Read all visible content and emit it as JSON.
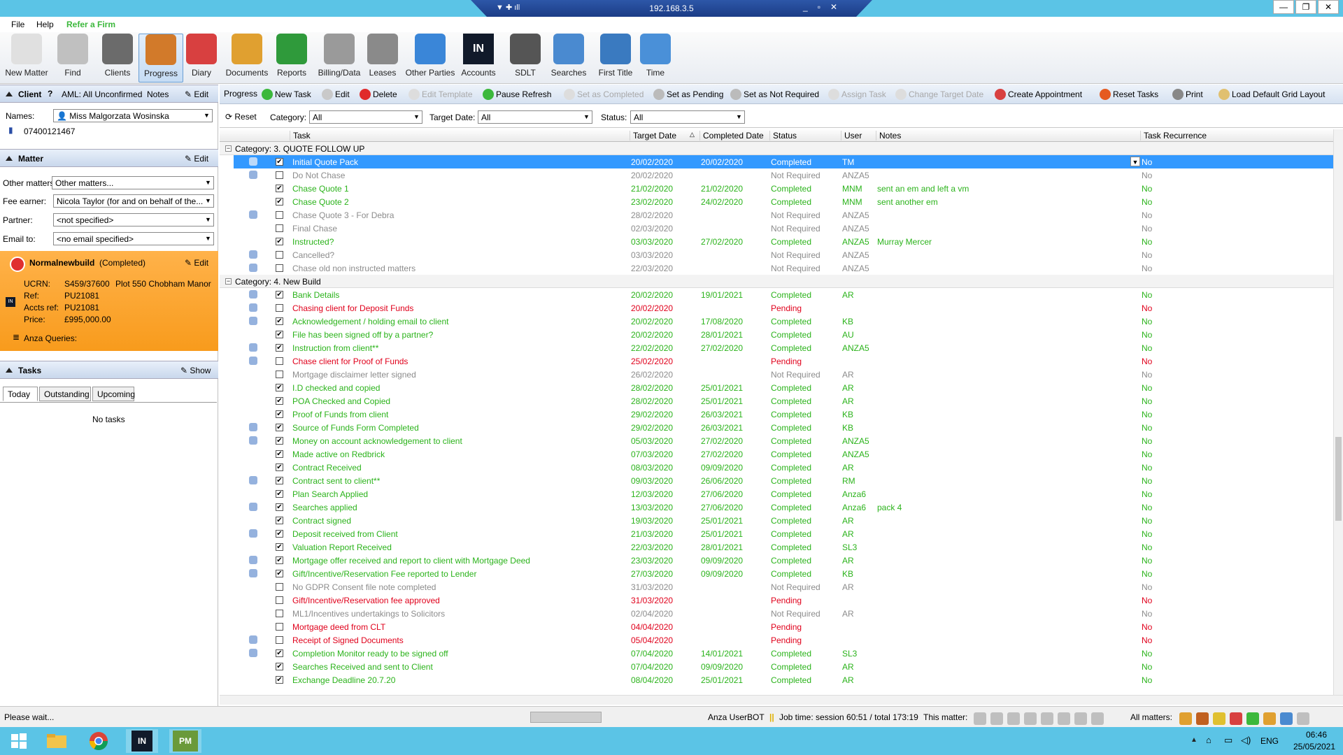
{
  "rdp": {
    "ip": "192.168.3.5"
  },
  "menu": {
    "file": "File",
    "help": "Help",
    "refer": "Refer a Firm"
  },
  "ribbon": [
    {
      "label": "New Matter",
      "icon": "document-icon",
      "color": "#e0e0e0"
    },
    {
      "label": "Find",
      "icon": "magnifier-icon",
      "color": "#c0c0c0"
    },
    {
      "label": "Clients",
      "icon": "people-icon",
      "color": "#6b6b6b"
    },
    {
      "label": "Progress",
      "icon": "progress-tag-icon",
      "color": "#d27a2a"
    },
    {
      "label": "Diary",
      "icon": "calendar-icon",
      "color": "#d84040"
    },
    {
      "label": "Documents",
      "icon": "documents-icon",
      "color": "#e0a030"
    },
    {
      "label": "Reports",
      "icon": "excel-icon",
      "color": "#2f9a3b"
    },
    {
      "label": "Billing/Data",
      "icon": "printer-icon",
      "color": "#9a9a9a"
    },
    {
      "label": "Leases",
      "icon": "calculator-icon",
      "color": "#8a8a8a"
    },
    {
      "label": "Other Parties",
      "icon": "person-icon",
      "color": "#3a86d8"
    },
    {
      "label": "Accounts",
      "icon": "in-logo-icon",
      "color": "#111a2a"
    },
    {
      "label": "SDLT",
      "icon": "house-icon",
      "color": "#555555"
    },
    {
      "label": "Searches",
      "icon": "globe-icon",
      "color": "#4a8ad0"
    },
    {
      "label": "First Title",
      "icon": "globe-pen-icon",
      "color": "#3a7ac0"
    },
    {
      "label": "Time",
      "icon": "stopwatch-icon",
      "color": "#4a90d8"
    }
  ],
  "client": {
    "title": "Client",
    "aml": "AML: All Unconfirmed",
    "notes": "Notes",
    "edit": "Edit",
    "names_label": "Names:",
    "name": "Miss Malgorzata Wosinska",
    "phone": "07400121467"
  },
  "matter": {
    "title": "Matter",
    "edit": "Edit",
    "other_label": "Other matters:",
    "other_value": "Other matters...",
    "fee_label": "Fee earner:",
    "fee_value": "Nicola Taylor (for and on behalf of the...",
    "partner_label": "Partner:",
    "partner_value": "<not specified>",
    "email_label": "Email to:",
    "email_value": "<no email specified>"
  },
  "matterbox": {
    "name": "Normalnewbuild",
    "state": "(Completed)",
    "edit": "Edit",
    "ucrn_k": "UCRN:",
    "ucrn_v": "S459/37600",
    "plot": "Plot 550 Chobham Manor",
    "ref_k": "Ref:",
    "ref_v": "PU21081",
    "accts_k": "Accts ref:",
    "accts_v": "PU21081",
    "price_k": "Price:",
    "price_v": "£995,000.00",
    "queries": "Anza Queries:"
  },
  "tasks": {
    "title": "Tasks",
    "show": "Show",
    "tabs": [
      "Today",
      "Outstanding",
      "Upcoming"
    ],
    "empty": "No tasks"
  },
  "toolbar": {
    "progress": "Progress",
    "new_task": "New Task",
    "edit": "Edit",
    "delete": "Delete",
    "edit_template": "Edit Template",
    "pause": "Pause Refresh",
    "set_completed": "Set as Completed",
    "set_pending": "Set as Pending",
    "set_not_required": "Set as Not Required",
    "assign": "Assign Task",
    "change_target": "Change Target Date",
    "create_appt": "Create Appointment",
    "reset_tasks": "Reset Tasks",
    "print": "Print",
    "load_grid": "Load Default Grid Layout"
  },
  "filter": {
    "reset": "Reset",
    "category_label": "Category:",
    "category": "All",
    "target_label": "Target Date:",
    "target": "All",
    "status_label": "Status:",
    "status": "All"
  },
  "columns": {
    "task": "Task",
    "target": "Target Date",
    "completed": "Completed Date",
    "status": "Status",
    "user": "User",
    "notes": "Notes",
    "recurrence": "Task Recurrence"
  },
  "categories": [
    "Category: 3. QUOTE FOLLOW UP",
    "Category: 4. New Build"
  ],
  "rows": [
    {
      "cat": 0,
      "icon": true,
      "checked": true,
      "task": "Initial Quote Pack",
      "target": "20/02/2020",
      "completed": "20/02/2020",
      "status": "Completed",
      "user": "TM",
      "notes": "",
      "rec": "No",
      "st": "sel"
    },
    {
      "cat": 0,
      "icon": true,
      "checked": false,
      "task": "Do Not Chase",
      "target": "20/02/2020",
      "completed": "",
      "status": "Not Required",
      "user": "ANZA5",
      "notes": "",
      "rec": "No",
      "st": "n"
    },
    {
      "cat": 0,
      "icon": false,
      "checked": true,
      "task": "Chase Quote 1",
      "target": "21/02/2020",
      "completed": "21/02/2020",
      "status": "Completed",
      "user": "MNM",
      "notes": "sent an em and left a vm",
      "rec": "No",
      "st": "g"
    },
    {
      "cat": 0,
      "icon": false,
      "checked": true,
      "task": "Chase Quote 2",
      "target": "23/02/2020",
      "completed": "24/02/2020",
      "status": "Completed",
      "user": "MNM",
      "notes": "sent another em",
      "rec": "No",
      "st": "g"
    },
    {
      "cat": 0,
      "icon": true,
      "checked": false,
      "task": "Chase Quote 3 - For Debra",
      "target": "28/02/2020",
      "completed": "",
      "status": "Not Required",
      "user": "ANZA5",
      "notes": "",
      "rec": "No",
      "st": "n"
    },
    {
      "cat": 0,
      "icon": false,
      "checked": false,
      "task": "Final Chase",
      "target": "02/03/2020",
      "completed": "",
      "status": "Not Required",
      "user": "ANZA5",
      "notes": "",
      "rec": "No",
      "st": "n"
    },
    {
      "cat": 0,
      "icon": false,
      "checked": true,
      "task": "Instructed?",
      "target": "03/03/2020",
      "completed": "27/02/2020",
      "status": "Completed",
      "user": "ANZA5",
      "notes": "Murray Mercer",
      "rec": "No",
      "st": "g"
    },
    {
      "cat": 0,
      "icon": true,
      "checked": false,
      "task": "Cancelled?",
      "target": "03/03/2020",
      "completed": "",
      "status": "Not Required",
      "user": "ANZA5",
      "notes": "",
      "rec": "No",
      "st": "n"
    },
    {
      "cat": 0,
      "icon": true,
      "checked": false,
      "task": "Chase old non instructed matters",
      "target": "22/03/2020",
      "completed": "",
      "status": "Not Required",
      "user": "ANZA5",
      "notes": "",
      "rec": "No",
      "st": "n"
    },
    {
      "cat": 1,
      "icon": true,
      "checked": true,
      "task": "Bank Details",
      "target": "20/02/2020",
      "completed": "19/01/2021",
      "status": "Completed",
      "user": "AR",
      "notes": "",
      "rec": "No",
      "st": "g"
    },
    {
      "cat": 1,
      "icon": true,
      "checked": false,
      "task": "Chasing client for Deposit Funds",
      "target": "20/02/2020",
      "completed": "",
      "status": "Pending",
      "user": "",
      "notes": "",
      "rec": "No",
      "st": "r"
    },
    {
      "cat": 1,
      "icon": true,
      "checked": true,
      "task": "Acknowledgement / holding email to client",
      "target": "20/02/2020",
      "completed": "17/08/2020",
      "status": "Completed",
      "user": "KB",
      "notes": "",
      "rec": "No",
      "st": "g"
    },
    {
      "cat": 1,
      "icon": false,
      "checked": true,
      "task": "File has been signed off by a partner?",
      "target": "20/02/2020",
      "completed": "28/01/2021",
      "status": "Completed",
      "user": "AU",
      "notes": "",
      "rec": "No",
      "st": "g"
    },
    {
      "cat": 1,
      "icon": true,
      "checked": true,
      "task": "Instruction from client**",
      "target": "22/02/2020",
      "completed": "27/02/2020",
      "status": "Completed",
      "user": "ANZA5",
      "notes": "",
      "rec": "No",
      "st": "g"
    },
    {
      "cat": 1,
      "icon": true,
      "checked": false,
      "task": "Chase client for Proof of Funds",
      "target": "25/02/2020",
      "completed": "",
      "status": "Pending",
      "user": "",
      "notes": "",
      "rec": "No",
      "st": "r"
    },
    {
      "cat": 1,
      "icon": false,
      "checked": false,
      "task": "Mortgage disclaimer letter signed",
      "target": "26/02/2020",
      "completed": "",
      "status": "Not Required",
      "user": "AR",
      "notes": "",
      "rec": "No",
      "st": "n"
    },
    {
      "cat": 1,
      "icon": false,
      "checked": true,
      "task": "I.D checked and copied",
      "target": "28/02/2020",
      "completed": "25/01/2021",
      "status": "Completed",
      "user": "AR",
      "notes": "",
      "rec": "No",
      "st": "g"
    },
    {
      "cat": 1,
      "icon": false,
      "checked": true,
      "task": "POA Checked and Copied",
      "target": "28/02/2020",
      "completed": "25/01/2021",
      "status": "Completed",
      "user": "AR",
      "notes": "",
      "rec": "No",
      "st": "g"
    },
    {
      "cat": 1,
      "icon": false,
      "checked": true,
      "task": "Proof of Funds from client",
      "target": "29/02/2020",
      "completed": "26/03/2021",
      "status": "Completed",
      "user": "KB",
      "notes": "",
      "rec": "No",
      "st": "g"
    },
    {
      "cat": 1,
      "icon": true,
      "checked": true,
      "task": "Source of Funds Form Completed",
      "target": "29/02/2020",
      "completed": "26/03/2021",
      "status": "Completed",
      "user": "KB",
      "notes": "",
      "rec": "No",
      "st": "g"
    },
    {
      "cat": 1,
      "icon": true,
      "checked": true,
      "task": "Money on account acknowledgement to client",
      "target": "05/03/2020",
      "completed": "27/02/2020",
      "status": "Completed",
      "user": "ANZA5",
      "notes": "",
      "rec": "No",
      "st": "g"
    },
    {
      "cat": 1,
      "icon": false,
      "checked": true,
      "task": "Made active on Redbrick",
      "target": "07/03/2020",
      "completed": "27/02/2020",
      "status": "Completed",
      "user": "ANZA5",
      "notes": "",
      "rec": "No",
      "st": "g"
    },
    {
      "cat": 1,
      "icon": false,
      "checked": true,
      "task": "Contract Received",
      "target": "08/03/2020",
      "completed": "09/09/2020",
      "status": "Completed",
      "user": "AR",
      "notes": "",
      "rec": "No",
      "st": "g"
    },
    {
      "cat": 1,
      "icon": true,
      "checked": true,
      "task": "Contract sent to client**",
      "target": "09/03/2020",
      "completed": "26/06/2020",
      "status": "Completed",
      "user": "RM",
      "notes": "",
      "rec": "No",
      "st": "g"
    },
    {
      "cat": 1,
      "icon": false,
      "checked": true,
      "task": "Plan Search Applied",
      "target": "12/03/2020",
      "completed": "27/06/2020",
      "status": "Completed",
      "user": "Anza6",
      "notes": "",
      "rec": "No",
      "st": "g"
    },
    {
      "cat": 1,
      "icon": true,
      "checked": true,
      "task": "Searches applied",
      "target": "13/03/2020",
      "completed": "27/06/2020",
      "status": "Completed",
      "user": "Anza6",
      "notes": "pack 4",
      "rec": "No",
      "st": "g"
    },
    {
      "cat": 1,
      "icon": false,
      "checked": true,
      "task": "Contract signed",
      "target": "19/03/2020",
      "completed": "25/01/2021",
      "status": "Completed",
      "user": "AR",
      "notes": "",
      "rec": "No",
      "st": "g"
    },
    {
      "cat": 1,
      "icon": true,
      "checked": true,
      "task": "Deposit received from Client",
      "target": "21/03/2020",
      "completed": "25/01/2021",
      "status": "Completed",
      "user": "AR",
      "notes": "",
      "rec": "No",
      "st": "g"
    },
    {
      "cat": 1,
      "icon": false,
      "checked": true,
      "task": "Valuation Report Received",
      "target": "22/03/2020",
      "completed": "28/01/2021",
      "status": "Completed",
      "user": "SL3",
      "notes": "",
      "rec": "No",
      "st": "g"
    },
    {
      "cat": 1,
      "icon": true,
      "checked": true,
      "task": "Mortgage offer received and report to client with Mortgage Deed",
      "target": "23/03/2020",
      "completed": "09/09/2020",
      "status": "Completed",
      "user": "AR",
      "notes": "",
      "rec": "No",
      "st": "g"
    },
    {
      "cat": 1,
      "icon": true,
      "checked": true,
      "task": "Gift/Incentive/Reservation Fee reported to Lender",
      "target": "27/03/2020",
      "completed": "09/09/2020",
      "status": "Completed",
      "user": "KB",
      "notes": "",
      "rec": "No",
      "st": "g"
    },
    {
      "cat": 1,
      "icon": false,
      "checked": false,
      "task": "No GDPR Consent file note completed",
      "target": "31/03/2020",
      "completed": "",
      "status": "Not Required",
      "user": "AR",
      "notes": "",
      "rec": "No",
      "st": "n"
    },
    {
      "cat": 1,
      "icon": false,
      "checked": false,
      "task": "Gift/Incentive/Reservation fee approved",
      "target": "31/03/2020",
      "completed": "",
      "status": "Pending",
      "user": "",
      "notes": "",
      "rec": "No",
      "st": "r"
    },
    {
      "cat": 1,
      "icon": false,
      "checked": false,
      "task": "ML1/Incentives undertakings to Solicitors",
      "target": "02/04/2020",
      "completed": "",
      "status": "Not Required",
      "user": "AR",
      "notes": "",
      "rec": "No",
      "st": "n"
    },
    {
      "cat": 1,
      "icon": false,
      "checked": false,
      "task": "Mortgage deed from CLT",
      "target": "04/04/2020",
      "completed": "",
      "status": "Pending",
      "user": "",
      "notes": "",
      "rec": "No",
      "st": "r"
    },
    {
      "cat": 1,
      "icon": true,
      "checked": false,
      "task": "Receipt of Signed Documents",
      "target": "05/04/2020",
      "completed": "",
      "status": "Pending",
      "user": "",
      "notes": "",
      "rec": "No",
      "st": "r"
    },
    {
      "cat": 1,
      "icon": true,
      "checked": true,
      "task": "Completion Monitor ready to be signed off",
      "target": "07/04/2020",
      "completed": "14/01/2021",
      "status": "Completed",
      "user": "SL3",
      "notes": "",
      "rec": "No",
      "st": "g"
    },
    {
      "cat": 1,
      "icon": false,
      "checked": true,
      "task": "Searches Received and sent to Client",
      "target": "07/04/2020",
      "completed": "09/09/2020",
      "status": "Completed",
      "user": "AR",
      "notes": "",
      "rec": "No",
      "st": "g"
    },
    {
      "cat": 1,
      "icon": false,
      "checked": true,
      "task": "Exchange Deadline 20.7.20",
      "target": "08/04/2020",
      "completed": "25/01/2021",
      "status": "Completed",
      "user": "AR",
      "notes": "",
      "rec": "No",
      "st": "g"
    }
  ],
  "status": {
    "wait": "Please wait...",
    "user": "Anza UserBOT",
    "job": "Job time: session 60:51 / total 173:19",
    "this_matter": "This matter:",
    "all_matters": "All matters:"
  },
  "taskbar": {
    "lang": "ENG",
    "time": "06:46",
    "date": "25/05/2021",
    "in": "IN",
    "pm": "PM"
  }
}
